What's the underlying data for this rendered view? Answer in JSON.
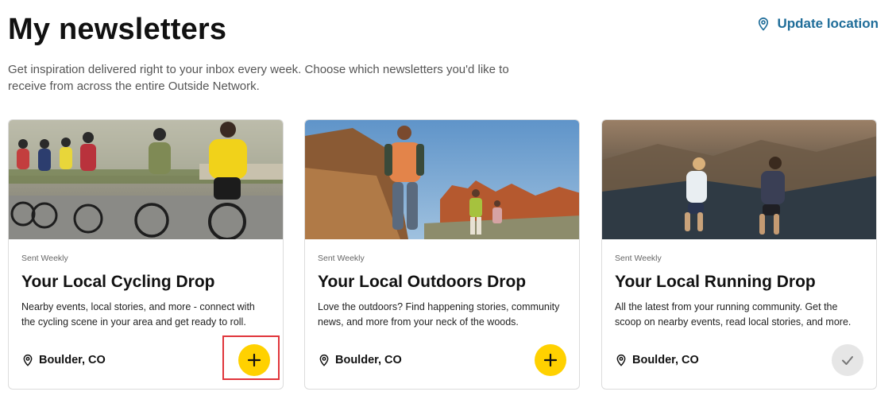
{
  "header": {
    "title": "My newsletters",
    "update_location_label": "Update location",
    "subtitle": "Get inspiration delivered right to your inbox every week. Choose which newsletters you'd like to receive from across the entire Outside Network."
  },
  "cards": [
    {
      "frequency": "Sent Weekly",
      "title": "Your Local Cycling Drop",
      "description": "Nearby events, local stories, and more - connect with the cycling scene in your area and get ready to roll.",
      "location": "Boulder, CO",
      "action": "add",
      "action_icon": "plus-icon"
    },
    {
      "frequency": "Sent Weekly",
      "title": "Your Local Outdoors Drop",
      "description": "Love the outdoors? Find happening stories, community news, and more from your neck of the woods.",
      "location": "Boulder, CO",
      "action": "add",
      "action_icon": "plus-icon"
    },
    {
      "frequency": "Sent Weekly",
      "title": "Your Local Running Drop",
      "description": "All the latest from your running community. Get the scoop on nearby events, read local stories, and more.",
      "location": "Boulder, CO",
      "action": "subscribed",
      "action_icon": "check-icon"
    }
  ],
  "colors": {
    "accent_yellow": "#ffd100",
    "link_blue": "#1f6d99",
    "subscribed_gray": "#e6e6e6",
    "highlight_red": "#e0353b"
  }
}
